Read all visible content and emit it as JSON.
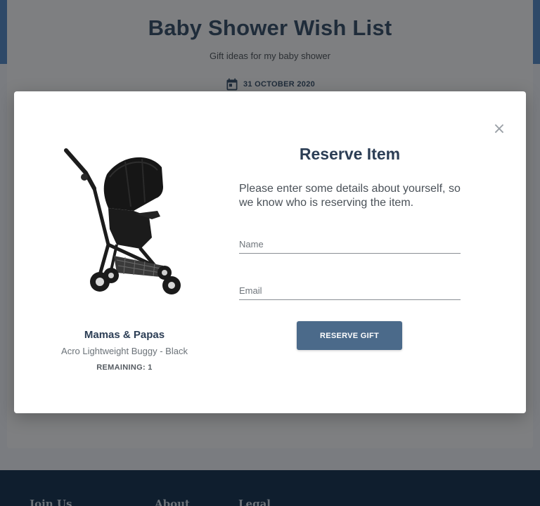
{
  "page": {
    "title": "Baby Shower Wish List",
    "subtitle": "Gift ideas for my baby shower",
    "date": "31 OCTOBER 2020",
    "date_icon": "calendar-icon"
  },
  "footer": {
    "columns": [
      "Join Us",
      "About",
      "Legal"
    ]
  },
  "modal": {
    "title": "Reserve Item",
    "instructions": "Please enter some details about yourself, so we know who is reserving the item.",
    "close_label": "×",
    "name_field": {
      "value": "",
      "placeholder": "Name"
    },
    "email_field": {
      "value": "",
      "placeholder": "Email"
    },
    "submit_label": "RESERVE GIFT"
  },
  "product": {
    "brand": "Mamas & Papas",
    "name": "Acro Lightweight Buggy - Black",
    "remaining": "REMAINING: 1",
    "image_icon": "stroller-image"
  },
  "colors": {
    "accent": "#4b6a8a",
    "heading": "#2c3e55",
    "footer_bg": "#0f1e2e"
  }
}
